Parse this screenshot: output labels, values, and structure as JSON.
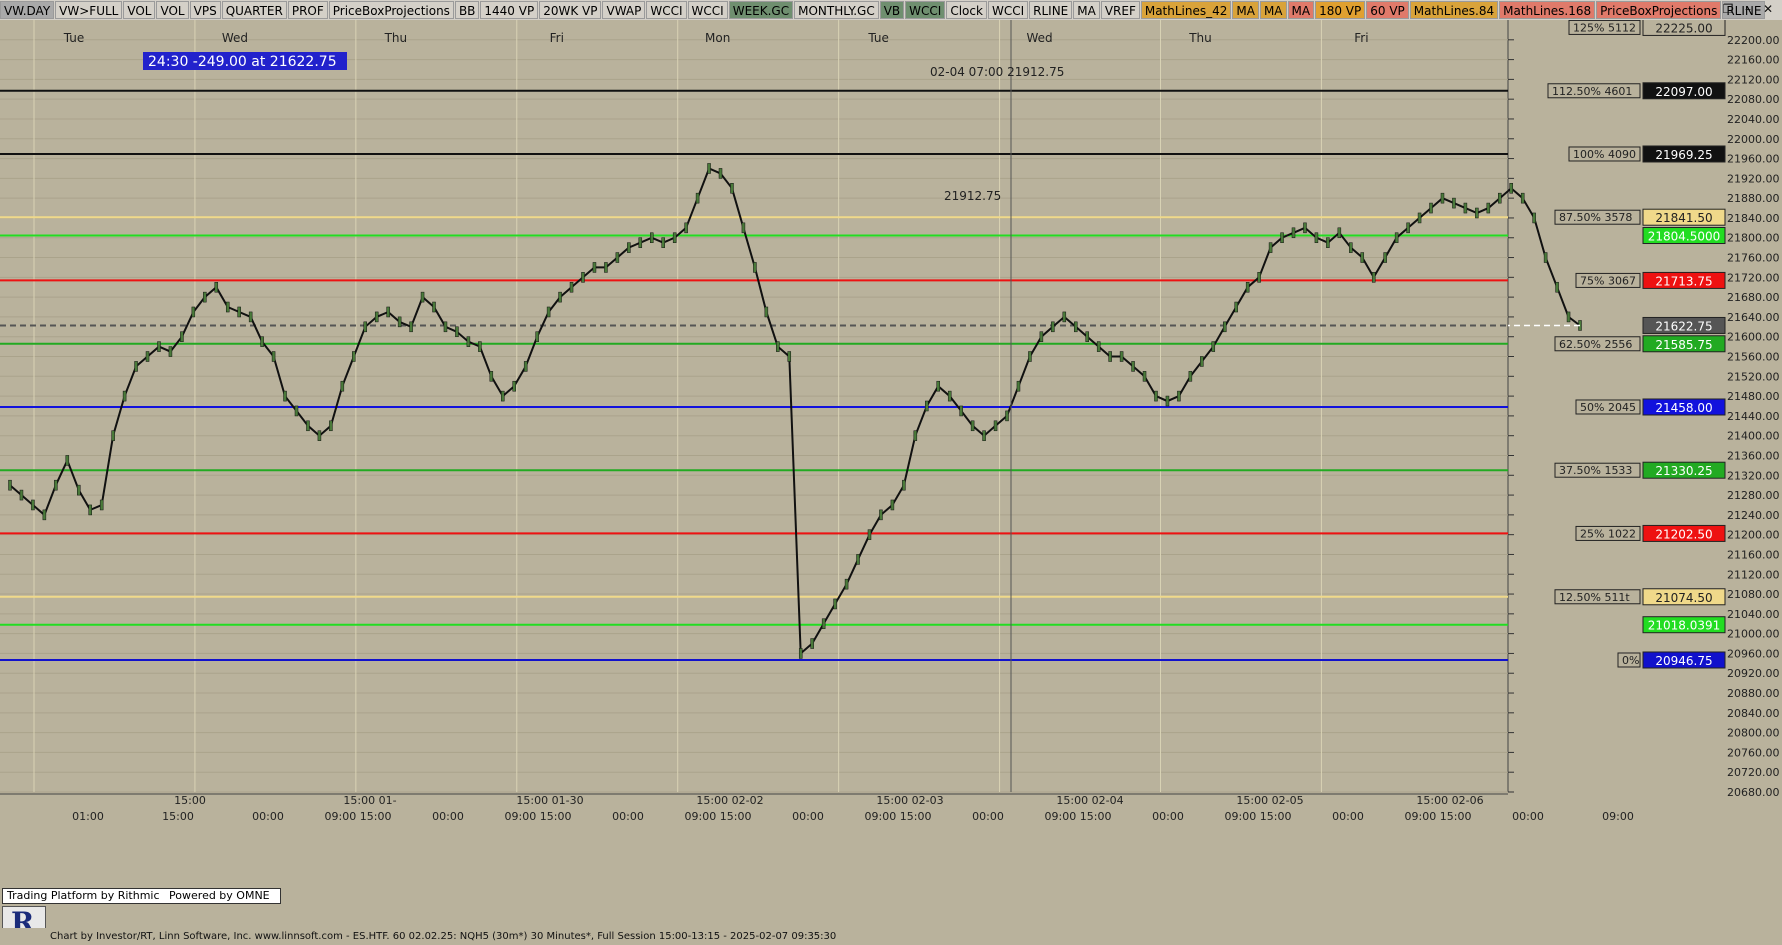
{
  "toolbar": {
    "buttons": [
      {
        "label": "VW.DAY",
        "bg": "#a9a9a9"
      },
      {
        "label": "VW>FULL",
        "bg": "#d4d0c8"
      },
      {
        "label": "VOL",
        "bg": "#d4d0c8"
      },
      {
        "label": "VOL",
        "bg": "#d4d0c8"
      },
      {
        "label": "VPS",
        "bg": "#d4d0c8"
      },
      {
        "label": "QUARTER",
        "bg": "#d4d0c8"
      },
      {
        "label": "PROF",
        "bg": "#d4d0c8"
      },
      {
        "label": "PriceBoxProjections",
        "bg": "#d4d0c8"
      },
      {
        "label": "BB",
        "bg": "#d4d0c8"
      },
      {
        "label": "1440 VP",
        "bg": "#d4d0c8"
      },
      {
        "label": "20WK VP",
        "bg": "#d4d0c8"
      },
      {
        "label": "VWAP",
        "bg": "#d4d0c8"
      },
      {
        "label": "WCCI",
        "bg": "#d4d0c8"
      },
      {
        "label": "WCCI",
        "bg": "#d4d0c8"
      },
      {
        "label": "WEEK.GC",
        "bg": "#6f8f6f"
      },
      {
        "label": "MONTHLY.GC",
        "bg": "#d4d0c8"
      },
      {
        "label": "VB",
        "bg": "#6f8f6f"
      },
      {
        "label": "WCCI",
        "bg": "#6f8f6f"
      },
      {
        "label": "Clock",
        "bg": "#d4d0c8"
      },
      {
        "label": "WCCI",
        "bg": "#d4d0c8"
      },
      {
        "label": "RLINE",
        "bg": "#d4d0c8"
      },
      {
        "label": "MA",
        "bg": "#d4d0c8"
      },
      {
        "label": "VREF",
        "bg": "#d4d0c8"
      },
      {
        "label": "MathLines_42",
        "bg": "#d9a33a"
      },
      {
        "label": "MA",
        "bg": "#d9a33a"
      },
      {
        "label": "MA",
        "bg": "#d9a33a"
      },
      {
        "label": "MA",
        "bg": "#e07a6a"
      },
      {
        "label": "180 VP",
        "bg": "#e0a030"
      },
      {
        "label": "60 VP",
        "bg": "#e07a6a"
      },
      {
        "label": "MathLines.84",
        "bg": "#d9a33a"
      },
      {
        "label": "MathLines.168",
        "bg": "#e07a6a"
      },
      {
        "label": "PriceBoxProjections",
        "bg": "#e07a6a"
      },
      {
        "label": "RLINE",
        "bg": "#a9a9a9"
      }
    ],
    "window_controls": [
      "restore-icon",
      "minimize-icon",
      "close-icon"
    ]
  },
  "info_box": "24:30  -249.00 at 21622.75",
  "crosshair_readout": {
    "time": "02-04 07:00",
    "price": "21912.75"
  },
  "mid_label": "21912.75",
  "footer": {
    "text": "Chart by Investor/RT, Linn Software, Inc. www.linnsoft.com - ES.HTF. 60   02.02.25: NQH5 (30m*) 30 Minutes*, Full Session 15:00-13:15 - 2025-02-07 09:35:30",
    "badge_left": "Trading Platform by Rithmic",
    "badge_right": "Powered by OMNE",
    "logo": "R"
  },
  "chart_data": {
    "type": "line",
    "title": "",
    "y_axis": {
      "min": 20680,
      "max": 22240,
      "ticks": [
        22200,
        22160,
        22120,
        22080,
        22040,
        22000,
        21960,
        21920,
        21880,
        21840,
        21800,
        21760,
        21720,
        21680,
        21640,
        21600,
        21560,
        21520,
        21480,
        21440,
        21400,
        21360,
        21320,
        21280,
        21240,
        21200,
        21160,
        21120,
        21080,
        21040,
        21000,
        20960,
        20920,
        20880,
        20840,
        20800,
        20760,
        20720,
        20680
      ]
    },
    "x_axis": {
      "day_labels": [
        "Tue",
        "Wed",
        "Thu",
        "Fri",
        "Mon",
        "Tue",
        "Wed",
        "Thu",
        "Fri"
      ],
      "lower_labels": [
        "01:00",
        "15:00",
        "00:00",
        "09:00 15:00",
        "00:00",
        "09:00 15:00",
        "00:00",
        "09:00 15:00",
        "00:00",
        "09:00 15:00",
        "00:00",
        "09:00 15:00",
        "00:00",
        "09:00 15:00",
        "00:00",
        "09:00 15:00",
        "00:00",
        "09:00"
      ],
      "session_labels": [
        "15:00",
        "15:00 01-",
        "15:00 01-30",
        "15:00 02-02",
        "15:00 02-03",
        "15:00 02-04",
        "15:00 02-05",
        "15:00 02-06"
      ]
    },
    "grid": true,
    "levels": [
      {
        "label": "125% 5112",
        "value": "22225.00",
        "price": 22225.0,
        "color": "#b9b29c",
        "line": "none"
      },
      {
        "label": "112.50% 4601",
        "value": "22097.00",
        "price": 22097.0,
        "color": "#111111",
        "line": "solid"
      },
      {
        "label": "100% 4090",
        "value": "21969.25",
        "price": 21969.25,
        "color": "#111111",
        "line": "solid"
      },
      {
        "label": "87.50% 3578",
        "value": "21841.50",
        "price": 21841.5,
        "color": "#f0d98a",
        "line": "solid"
      },
      {
        "label": "",
        "value": "21804.5000",
        "price": 21804.5,
        "color": "#22dd22",
        "line": "solid"
      },
      {
        "label": "75% 3067",
        "value": "21713.75",
        "price": 21713.75,
        "color": "#ee1111",
        "line": "solid"
      },
      {
        "label": "",
        "value": "21622.75",
        "price": 21622.75,
        "color": "#555555",
        "line": "dash"
      },
      {
        "label": "62.50% 2556",
        "value": "21585.75",
        "price": 21585.75,
        "color": "#22aa22",
        "line": "solid"
      },
      {
        "label": "50% 2045",
        "value": "21458.00",
        "price": 21458.0,
        "color": "#1111dd",
        "line": "solid"
      },
      {
        "label": "37.50% 1533",
        "value": "21330.25",
        "price": 21330.25,
        "color": "#22aa22",
        "line": "solid"
      },
      {
        "label": "25% 1022",
        "value": "21202.50",
        "price": 21202.5,
        "color": "#ee1111",
        "line": "solid"
      },
      {
        "label": "12.50% 511t",
        "value": "21074.50",
        "price": 21074.5,
        "color": "#f0d98a",
        "line": "solid"
      },
      {
        "label": "",
        "value": "21018.0391",
        "price": 21018.0391,
        "color": "#22dd22",
        "line": "solid"
      },
      {
        "label": "0%",
        "value": "20946.75",
        "price": 20946.75,
        "color": "#1111cc",
        "line": "solid"
      }
    ],
    "last_price": 21622.75,
    "series": [
      {
        "prices": [
          21300,
          21280,
          21260,
          21240,
          21300,
          21350,
          21290,
          21250,
          21260,
          21400,
          21480,
          21540,
          21560,
          21580,
          21570,
          21600,
          21650,
          21680,
          21700,
          21660,
          21650,
          21640,
          21590,
          21560,
          21480,
          21450,
          21420,
          21400,
          21420,
          21500,
          21560,
          21620,
          21640,
          21650,
          21630,
          21620,
          21680,
          21660,
          21620,
          21610,
          21590,
          21580,
          21520,
          21480,
          21500,
          21540,
          21600,
          21650,
          21680,
          21700,
          21720,
          21740,
          21740,
          21760,
          21780,
          21790,
          21800,
          21790,
          21800,
          21820,
          21880,
          21940,
          21930,
          21900,
          21820,
          21740,
          21650,
          21580,
          21560,
          20960,
          20980,
          21020,
          21060,
          21100,
          21150,
          21200,
          21240,
          21260,
          21300,
          21400,
          21460,
          21500,
          21480,
          21450,
          21420,
          21400,
          21420,
          21440,
          21500,
          21560,
          21600,
          21620,
          21640,
          21620,
          21600,
          21580,
          21560,
          21560,
          21540,
          21520,
          21480,
          21470,
          21480,
          21520,
          21550,
          21580,
          21620,
          21660,
          21700,
          21720,
          21780,
          21800,
          21810,
          21820,
          21800,
          21790,
          21810,
          21780,
          21760,
          21720,
          21760,
          21800,
          21820,
          21840,
          21860,
          21880,
          21870,
          21860,
          21850,
          21860,
          21880,
          21900,
          21880,
          21840,
          21760,
          21700,
          21640,
          21622.75
        ]
      }
    ]
  }
}
